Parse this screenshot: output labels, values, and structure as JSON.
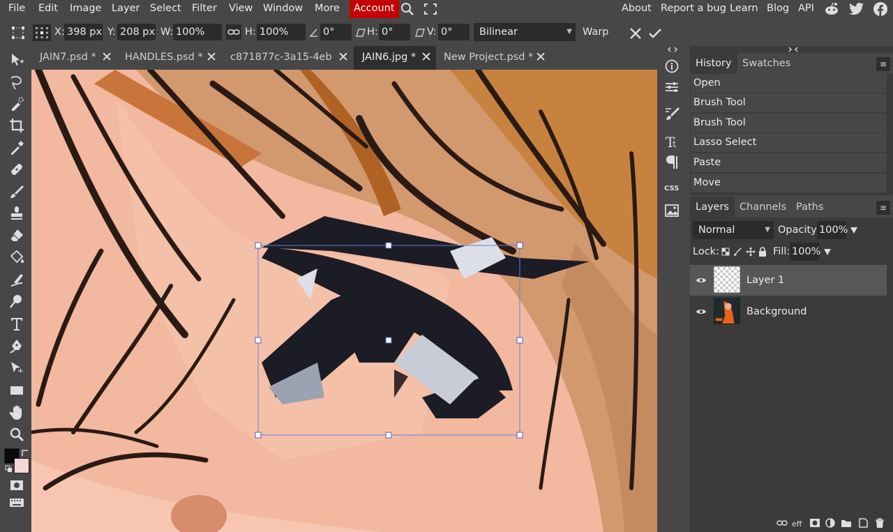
{
  "menu": {
    "items": [
      "File",
      "Edit",
      "Image",
      "Layer",
      "Select",
      "Filter",
      "View",
      "Window",
      "More"
    ],
    "account": "Account",
    "right_links": [
      "About",
      "Report a bug",
      "Learn",
      "Blog",
      "API"
    ],
    "account_color": "#c40000"
  },
  "options": {
    "x_label": "X:",
    "x_value": "398 px",
    "y_label": "Y:",
    "y_value": "208 px",
    "w_label": "W:",
    "w_value": "100%",
    "h_label": "H:",
    "h_value": "100%",
    "angle_value": "0°",
    "skew_h_label": "H:",
    "skew_h_value": "0°",
    "skew_v_label": "V:",
    "skew_v_value": "0°",
    "interpolation": "Bilinear",
    "warp_label": "Warp"
  },
  "tabs": [
    {
      "label": "JAIN7.psd *"
    },
    {
      "label": "HANDLES.psd *"
    },
    {
      "label": "c871877c-3a15-4eb *"
    },
    {
      "label": "JAIN6.jpg *"
    },
    {
      "label": "New Project.psd *"
    }
  ],
  "history": {
    "tabs": [
      "History",
      "Swatches"
    ],
    "items": [
      "Open",
      "Brush Tool",
      "Brush Tool",
      "Lasso Select",
      "Paste",
      "Move"
    ]
  },
  "layers": {
    "tabs": [
      "Layers",
      "Channels",
      "Paths"
    ],
    "blend_mode": "Normal",
    "opacity_label": "Opacity:",
    "opacity_value": "100%",
    "lock_label": "Lock:",
    "fill_label": "Fill:",
    "fill_value": "100%",
    "items": [
      {
        "name": "Layer 1",
        "selected": true
      },
      {
        "name": "Background",
        "selected": false
      }
    ]
  },
  "strip": {
    "css_label": "CSS"
  },
  "colors": {
    "foreground": "#0a0a0a",
    "background": "#f5d6d6"
  }
}
